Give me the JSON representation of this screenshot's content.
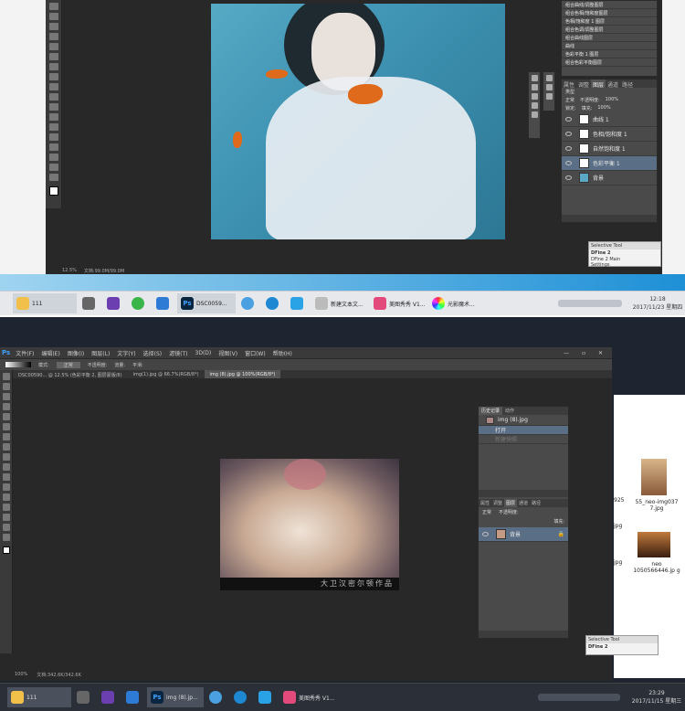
{
  "shot1": {
    "history_items": [
      "组合曲线/调整图层",
      "组合色相/饱和度图层",
      "色相/饱和度 1 图层",
      "组合色调/调整图层",
      "组合曲线图层",
      "曲线",
      "色彩平衡 1 图层",
      "组合色彩平衡图层"
    ],
    "panel_tabs": [
      "属性",
      "调整",
      "图层",
      "通道",
      "路径"
    ],
    "filter_label": "类型",
    "blend_mode": "正常",
    "opacity_label": "不透明度:",
    "opacity_value": "100%",
    "lock_label": "锁定:",
    "fill_label": "填充:",
    "fill_value": "100%",
    "layers": [
      {
        "name": "曲线 1",
        "selected": false
      },
      {
        "name": "色相/饱和度 1",
        "selected": false
      },
      {
        "name": "自然饱和度 1",
        "selected": false
      },
      {
        "name": "色彩平衡 1",
        "selected": true
      },
      {
        "name": "背景",
        "selected": false
      }
    ],
    "mini_panel": {
      "title": "Selective Tool",
      "name": "DFine 2",
      "labels": "DFine 2    Main",
      "settings": "Settings"
    },
    "status": {
      "zoom": "12.5%",
      "doc": "文档:99.0M/99.0M"
    },
    "taskbar": {
      "items": [
        "111",
        "",
        "",
        "",
        "PS",
        "",
        "",
        "",
        "新建文本文...",
        "美图秀秀 V1...",
        "光影魔术..."
      ],
      "time": "12:18",
      "date": "2017/11/23 星期四"
    }
  },
  "shot2": {
    "ps_logo": "Ps",
    "menu": [
      "文件(F)",
      "编辑(E)",
      "图像(I)",
      "图层(L)",
      "文字(Y)",
      "选择(S)",
      "滤镜(T)",
      "3D(D)",
      "视图(V)",
      "窗口(W)",
      "帮助(H)"
    ],
    "options": {
      "mode_label": "模式:",
      "mode": "正常",
      "opacity": "不透明度:",
      "flow": "流量:",
      "smooth": "平滑:"
    },
    "tabs": [
      "DSC00590... @ 12.5% (色彩平衡 2, 图层蒙版/8)",
      "img(1).jpg @ 66.7%(RGB/8*)",
      "img (8).jpg @ 100%(RGB/8*)"
    ],
    "history": {
      "tabs": [
        "历史记录",
        "动作"
      ],
      "snapshot": "img (8).jpg",
      "items": [
        "打开",
        "新建快照"
      ]
    },
    "layers_tabs": [
      "属性",
      "调整",
      "图层",
      "通道",
      "路径"
    ],
    "blend_mode": "正常",
    "opacity_label": "不透明度:",
    "fill_label": "填充:",
    "layer_name": "背景",
    "watermark": "大卫汉密尔顿作品",
    "status": {
      "zoom": "100%",
      "doc": "文档:342.6K/342.6K"
    },
    "mini_panel": {
      "title": "Selective Tool",
      "name": "DFine 2"
    },
    "explorer": [
      {
        "name": "55_neo-img037 7.jpg"
      },
      {
        "name": "neo 1050566446.jp g"
      }
    ],
    "side_labels": [
      "925",
      "jpg",
      "jpg"
    ],
    "taskbar": {
      "items": [
        "111",
        "",
        "",
        "",
        "img (8).jp...",
        "",
        "",
        "",
        "美图秀秀 V1..."
      ],
      "time": "23:29",
      "date": "2017/11/15 星期三"
    }
  },
  "colors": {
    "ps_dark": "#282828",
    "panel": "#4a4a4a",
    "selected_layer": "#5a6e86",
    "win_blue": "#1e90d6"
  }
}
